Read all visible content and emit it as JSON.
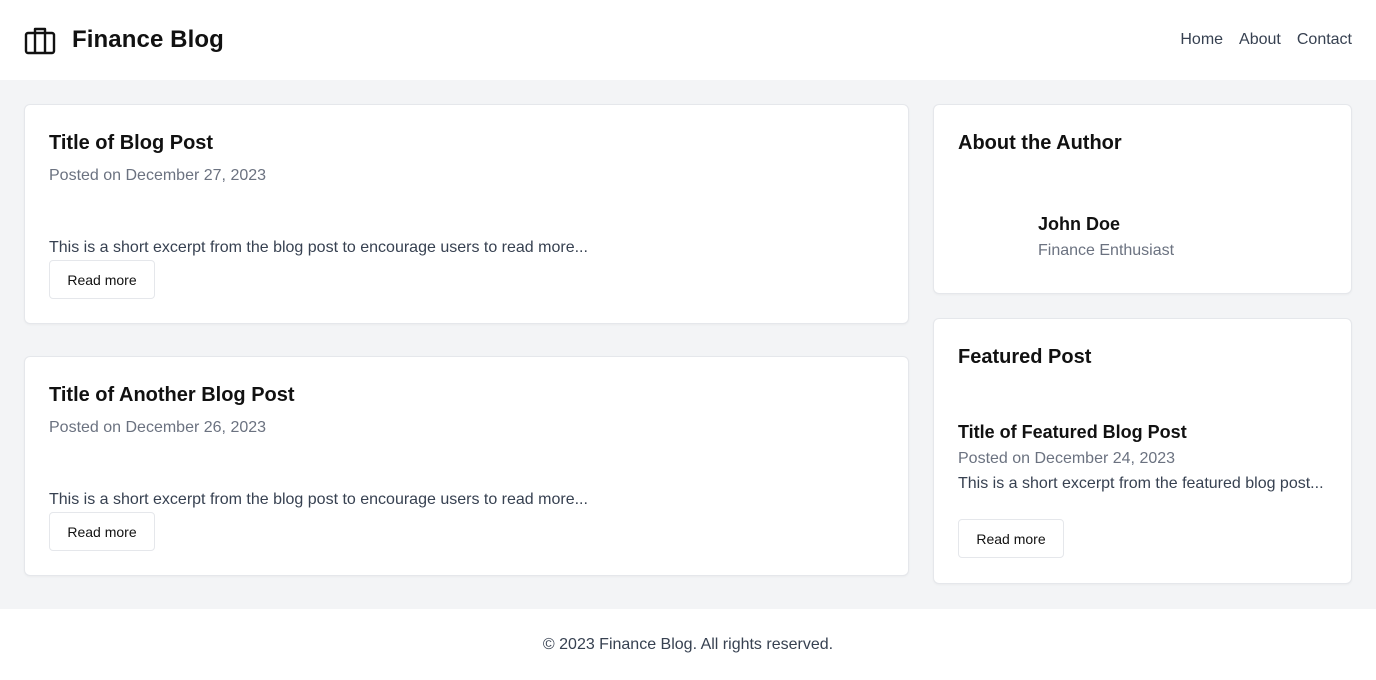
{
  "header": {
    "brand_icon": "briefcase-icon",
    "title": "Finance Blog",
    "nav": [
      "Home",
      "About",
      "Contact"
    ]
  },
  "posts": [
    {
      "title": "Title of Blog Post",
      "date": "Posted on December 27, 2023",
      "excerpt": "This is a short excerpt from the blog post to encourage users to read more...",
      "button": "Read more"
    },
    {
      "title": "Title of Another Blog Post",
      "date": "Posted on December 26, 2023",
      "excerpt": "This is a short excerpt from the blog post to encourage users to read more...",
      "button": "Read more"
    }
  ],
  "author_card": {
    "heading": "About the Author",
    "name": "John Doe",
    "role": "Finance Enthusiast"
  },
  "featured_card": {
    "heading": "Featured Post",
    "title": "Title of Featured Blog Post",
    "date": "Posted on December 24, 2023",
    "excerpt": "This is a short excerpt from the featured blog post...",
    "button": "Read more"
  },
  "footer": {
    "text": "© 2023 Finance Blog. All rights reserved."
  }
}
